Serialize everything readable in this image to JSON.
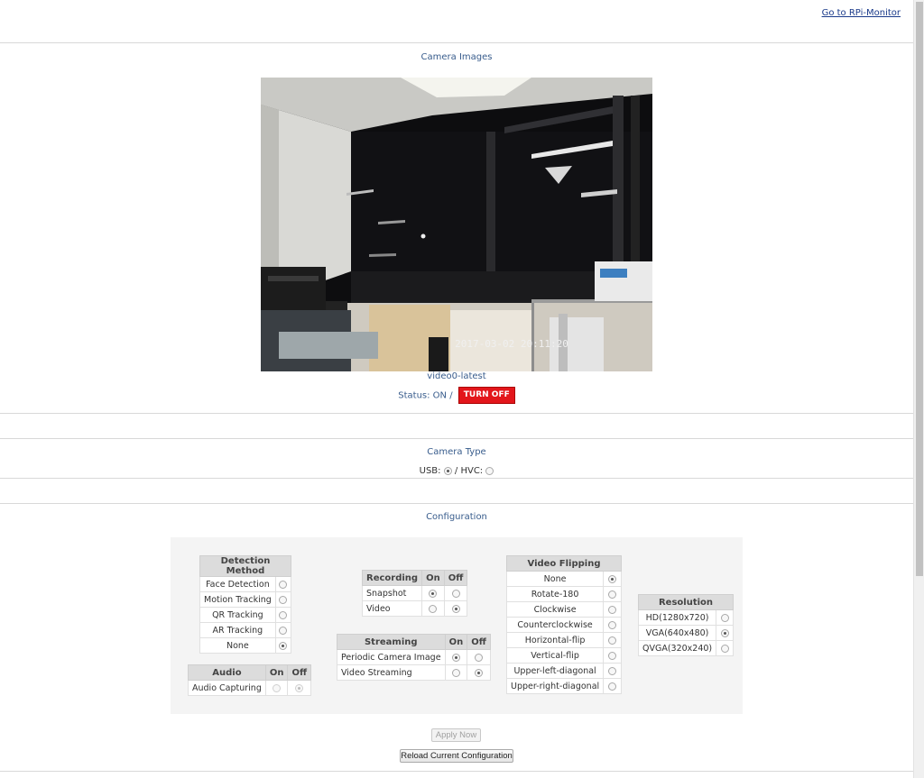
{
  "header": {
    "link_label": "Go to RPi-Monitor"
  },
  "camera_images": {
    "title": "Camera Images",
    "image_caption": "video0-latest",
    "image_timestamp": "2017-03-02 20:11:20",
    "status_label": "Status: ON /",
    "turn_off_label": "TURN OFF"
  },
  "camera_type": {
    "title": "Camera Type",
    "usb_label": "USB:",
    "separator": "/",
    "hvc_label": "HVC:",
    "selected": "USB"
  },
  "configuration": {
    "title": "Configuration",
    "detection": {
      "header": "Detection Method",
      "options": [
        "Face Detection",
        "Motion Tracking",
        "QR Tracking",
        "AR Tracking",
        "None"
      ],
      "selected": "None"
    },
    "audio": {
      "header": "Audio",
      "on": "On",
      "off": "Off",
      "rows": [
        {
          "label": "Audio Capturing",
          "value": "Off",
          "disabled": true
        }
      ]
    },
    "recording": {
      "header": "Recording",
      "on": "On",
      "off": "Off",
      "rows": [
        {
          "label": "Snapshot",
          "value": "On"
        },
        {
          "label": "Video",
          "value": "Off"
        }
      ]
    },
    "streaming": {
      "header": "Streaming",
      "on": "On",
      "off": "Off",
      "rows": [
        {
          "label": "Periodic Camera Image",
          "value": "On"
        },
        {
          "label": "Video Streaming",
          "value": "Off"
        }
      ]
    },
    "flipping": {
      "header": "Video Flipping",
      "options": [
        "None",
        "Rotate-180",
        "Clockwise",
        "Counterclockwise",
        "Horizontal-flip",
        "Vertical-flip",
        "Upper-left-diagonal",
        "Upper-right-diagonal"
      ],
      "selected": "None"
    },
    "resolution": {
      "header": "Resolution",
      "options": [
        "HD(1280x720)",
        "VGA(640x480)",
        "QVGA(320x240)"
      ],
      "selected": "VGA(640x480)"
    },
    "apply_label": "Apply Now",
    "reload_label": "Reload Current Configuration"
  },
  "colors": {
    "accent_text": "#385c8c",
    "turn_off_bg": "#e3161b",
    "link": "#1a3a8a"
  }
}
